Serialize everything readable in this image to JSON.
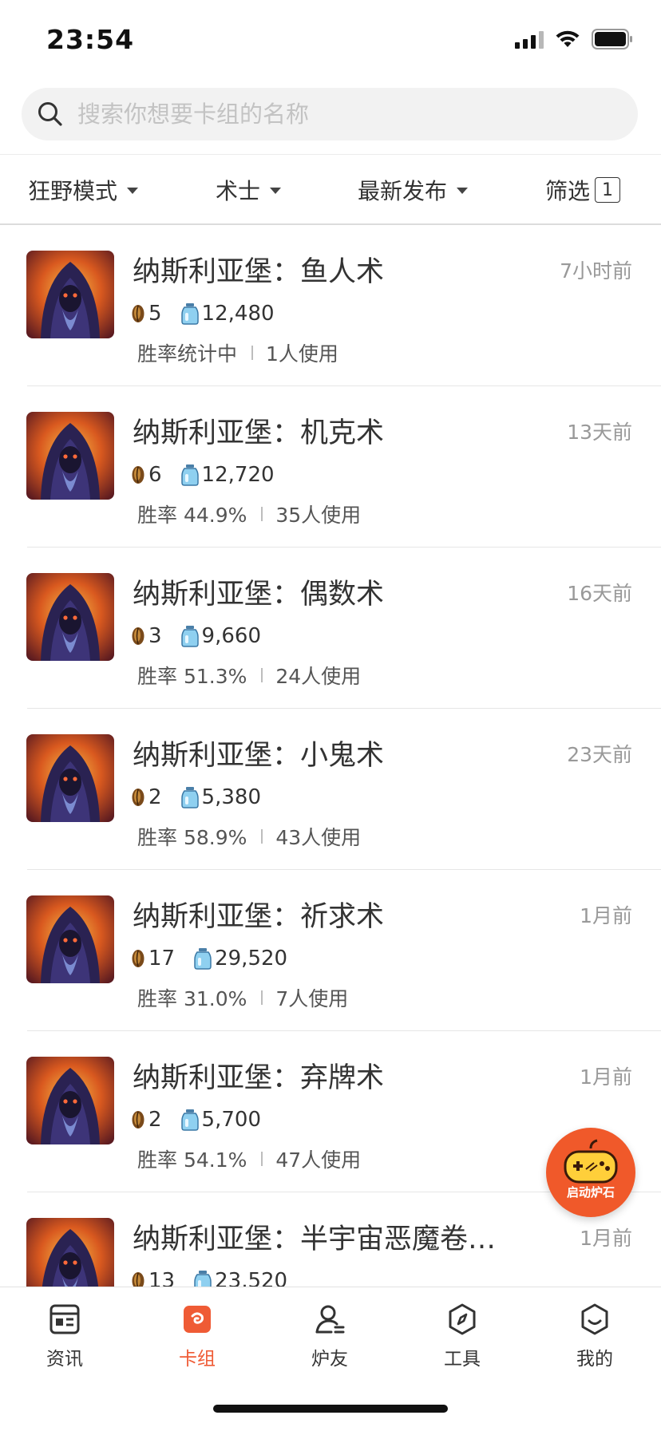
{
  "status": {
    "time": "23:54"
  },
  "search": {
    "placeholder": "搜索你想要卡组的名称"
  },
  "filters": {
    "mode": "狂野模式",
    "class": "术士",
    "sort": "最新发布",
    "filter_label": "筛选",
    "filter_count": "1"
  },
  "decks": [
    {
      "title": "纳斯利亚堡：鱼人术",
      "time": "7小时前",
      "dust": "5",
      "mana": "12,480",
      "winrate": "胜率统计中",
      "users": "1人使用"
    },
    {
      "title": "纳斯利亚堡：机克术",
      "time": "13天前",
      "dust": "6",
      "mana": "12,720",
      "winrate": "胜率 44.9%",
      "users": "35人使用"
    },
    {
      "title": "纳斯利亚堡：偶数术",
      "time": "16天前",
      "dust": "3",
      "mana": "9,660",
      "winrate": "胜率 51.3%",
      "users": "24人使用"
    },
    {
      "title": "纳斯利亚堡：小鬼术",
      "time": "23天前",
      "dust": "2",
      "mana": "5,380",
      "winrate": "胜率 58.9%",
      "users": "43人使用"
    },
    {
      "title": "纳斯利亚堡：祈求术",
      "time": "1月前",
      "dust": "17",
      "mana": "29,520",
      "winrate": "胜率 31.0%",
      "users": "7人使用"
    },
    {
      "title": "纳斯利亚堡：弃牌术",
      "time": "1月前",
      "dust": "2",
      "mana": "5,700",
      "winrate": "胜率 54.1%",
      "users": "47人使用"
    },
    {
      "title": "纳斯利亚堡：半宇宙恶魔卷…",
      "time": "1月前",
      "dust": "13",
      "mana": "23,520",
      "winrate": "",
      "users": ""
    }
  ],
  "float_button": {
    "label": "启动炉石"
  },
  "tabs": [
    {
      "label": "资讯",
      "icon": "news-icon"
    },
    {
      "label": "卡组",
      "icon": "deck-icon"
    },
    {
      "label": "炉友",
      "icon": "friends-icon"
    },
    {
      "label": "工具",
      "icon": "compass-icon"
    },
    {
      "label": "我的",
      "icon": "profile-icon"
    }
  ],
  "colors": {
    "accent": "#ef5b35",
    "float": "#f0592a"
  }
}
